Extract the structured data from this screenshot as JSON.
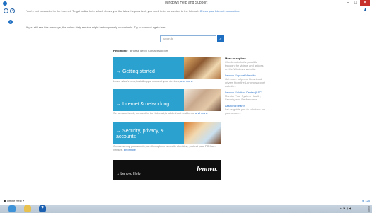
{
  "window": {
    "title": "Windows Help and Support",
    "icon": "help-icon"
  },
  "nav": {
    "back_icon": "back-arrow-icon",
    "forward_icon": "forward-arrow-icon",
    "notice_text": "You're not connected to the Internet. To get online help, which shows you the latest help content, you need to be connected to the Internet.",
    "notice_link": "Check your Internet connection."
  },
  "info": {
    "text": "If you still see this message, the online Help service might be temporarily unavailable. Try to connect again later."
  },
  "search": {
    "placeholder": "Search",
    "button_icon": "search-icon"
  },
  "help_links": {
    "home": "Help home",
    "browse": "Browse help",
    "contact": "Contact support",
    "sep": "|"
  },
  "tiles": [
    {
      "label": "Getting started",
      "desc": "Learn what's new, install apps, connect your devices,",
      "more": "and more."
    },
    {
      "label": "Internet & networking",
      "desc": "Set up a network, connect to the Internet, troubleshoot problems,",
      "more": "and more."
    },
    {
      "label": "Security, privacy, & accounts",
      "desc": "Create strong passwords, run through our security checklist, protect your PC from viruses,",
      "more": "and more."
    }
  ],
  "lenovo_tile": {
    "label": "Lenovo Help",
    "logo_text": "lenovo."
  },
  "right_column": {
    "heading": "More to explore",
    "intro": "Check out what's possible through the videos and articles on the Windows website.",
    "items": [
      {
        "title": "Lenovo Support Website",
        "text": "Get more help and Download drivers from the Lenovo support website."
      },
      {
        "title": "Lenovo Solution Center (LSC)",
        "text": "Monitor Your System Health, Security and Performance."
      },
      {
        "title": "Assisted Search",
        "text": "Let us guide you to solutions for your system."
      }
    ]
  },
  "status": {
    "offline": "Offline Help",
    "zoom": "125"
  },
  "taskbar": {
    "apps": [
      "internet-explorer-icon",
      "file-explorer-icon",
      "help-icon"
    ]
  },
  "colors": {
    "accent": "#2aa1cf",
    "close": "#c7312c",
    "link": "#2a71c7"
  }
}
